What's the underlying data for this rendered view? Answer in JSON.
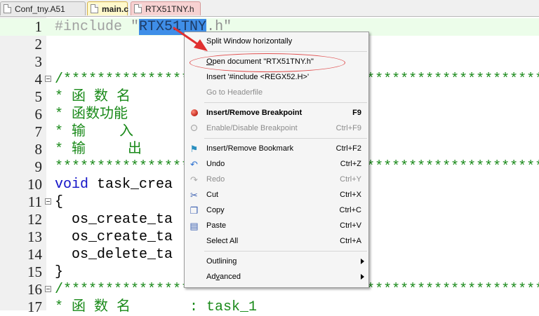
{
  "tabs": [
    {
      "label": "Conf_tny.A51",
      "active": false
    },
    {
      "label": "main.c",
      "active": true
    },
    {
      "label": "RTX51TNY.h",
      "active": false
    }
  ],
  "editor": {
    "lines": [
      {
        "num": "1",
        "parts": [
          {
            "t": "#include ",
            "c": "c-pre"
          },
          {
            "t": "\"",
            "c": "c-str"
          },
          {
            "t": "RTX51TNY",
            "c": "c-sel"
          },
          {
            "t": ".h\"",
            "c": "c-str"
          }
        ]
      },
      {
        "num": "2",
        "parts": []
      },
      {
        "num": "3",
        "parts": []
      },
      {
        "num": "4",
        "parts": [
          {
            "t": "/***********************************************************",
            "c": "c-com"
          }
        ]
      },
      {
        "num": "5",
        "parts": [
          {
            "t": "* 函 数 名",
            "c": "c-com"
          }
        ]
      },
      {
        "num": "6",
        "parts": [
          {
            "t": "* 函数功能",
            "c": "c-com"
          }
        ]
      },
      {
        "num": "7",
        "parts": [
          {
            "t": "* 输    入",
            "c": "c-com"
          }
        ]
      },
      {
        "num": "8",
        "parts": [
          {
            "t": "* 输     出",
            "c": "c-com"
          }
        ]
      },
      {
        "num": "9",
        "parts": [
          {
            "t": "***********************************************************",
            "c": "c-com"
          }
        ]
      },
      {
        "num": "10",
        "parts": [
          {
            "t": "void",
            "c": "c-kw"
          },
          {
            "t": " task_crea",
            "c": ""
          }
        ]
      },
      {
        "num": "11",
        "parts": [
          {
            "t": "{",
            "c": ""
          }
        ]
      },
      {
        "num": "12",
        "parts": [
          {
            "t": "  os_create_ta",
            "c": ""
          }
        ]
      },
      {
        "num": "13",
        "parts": [
          {
            "t": "  os_create_ta",
            "c": ""
          }
        ]
      },
      {
        "num": "14",
        "parts": [
          {
            "t": "  os_delete_ta",
            "c": ""
          }
        ]
      },
      {
        "num": "15",
        "parts": [
          {
            "t": "}",
            "c": ""
          }
        ]
      },
      {
        "num": "16",
        "parts": [
          {
            "t": "/***********************************************************",
            "c": "c-com"
          }
        ]
      },
      {
        "num": "17",
        "parts": [
          {
            "t": "* 函 数 名       : task_1",
            "c": "c-com"
          }
        ]
      }
    ]
  },
  "context_menu": {
    "items": [
      {
        "label": "Split Window horizontally",
        "shortcut": "",
        "icon": "",
        "disabled": false,
        "bold": false,
        "submenu": false
      },
      {
        "sep": true
      },
      {
        "label": "Open document \"RTX51TNY.h\"",
        "shortcut": "",
        "icon": "",
        "disabled": false,
        "bold": false,
        "submenu": false
      },
      {
        "label": "Insert '#include <REGX52.H>'",
        "shortcut": "",
        "icon": "",
        "disabled": false,
        "bold": false,
        "submenu": false
      },
      {
        "label": "Go to Headerfile",
        "shortcut": "",
        "icon": "",
        "disabled": true,
        "bold": false,
        "submenu": false
      },
      {
        "sep": true
      },
      {
        "label": "Insert/Remove Breakpoint",
        "shortcut": "F9",
        "icon": "breakpoint-icon",
        "disabled": false,
        "bold": true,
        "submenu": false
      },
      {
        "label": "Enable/Disable Breakpoint",
        "shortcut": "Ctrl+F9",
        "icon": "breakpoint-disabled-icon",
        "disabled": true,
        "bold": false,
        "submenu": false
      },
      {
        "sep": true
      },
      {
        "label": "Insert/Remove Bookmark",
        "shortcut": "Ctrl+F2",
        "icon": "bookmark-icon",
        "disabled": false,
        "bold": false,
        "submenu": false
      },
      {
        "label": "Undo",
        "shortcut": "Ctrl+Z",
        "icon": "undo-icon",
        "disabled": false,
        "bold": false,
        "submenu": false
      },
      {
        "label": "Redo",
        "shortcut": "Ctrl+Y",
        "icon": "redo-icon",
        "disabled": true,
        "bold": false,
        "submenu": false
      },
      {
        "label": "Cut",
        "shortcut": "Ctrl+X",
        "icon": "cut-icon",
        "disabled": false,
        "bold": false,
        "submenu": false
      },
      {
        "label": "Copy",
        "shortcut": "Ctrl+C",
        "icon": "copy-icon",
        "disabled": false,
        "bold": false,
        "submenu": false
      },
      {
        "label": "Paste",
        "shortcut": "Ctrl+V",
        "icon": "paste-icon",
        "disabled": false,
        "bold": false,
        "submenu": false
      },
      {
        "label": "Select All",
        "shortcut": "Ctrl+A",
        "icon": "",
        "disabled": false,
        "bold": false,
        "submenu": false
      },
      {
        "sep": true
      },
      {
        "label": "Outlining",
        "shortcut": "",
        "icon": "",
        "disabled": false,
        "bold": false,
        "submenu": true
      },
      {
        "label": "Advanced",
        "shortcut": "",
        "icon": "",
        "disabled": false,
        "bold": false,
        "submenu": true
      }
    ]
  },
  "colors": {
    "selection": "#3f8ee8",
    "comment": "#1a8a1a",
    "keyword": "#1414c8",
    "annotation": "#e03030"
  }
}
